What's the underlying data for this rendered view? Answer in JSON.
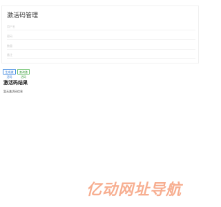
{
  "form": {
    "title": "激活码管理",
    "fields": [
      {
        "label": "用户名"
      },
      {
        "label": "密码"
      },
      {
        "label": "数量"
      },
      {
        "label": "备注"
      }
    ]
  },
  "actions": {
    "generate_label": "生成激活码",
    "query_label": "查询激活码"
  },
  "results": {
    "title": "激活码结果",
    "empty_text": "暂无激活码信息"
  },
  "watermark": {
    "text": "亿动网址导航"
  }
}
